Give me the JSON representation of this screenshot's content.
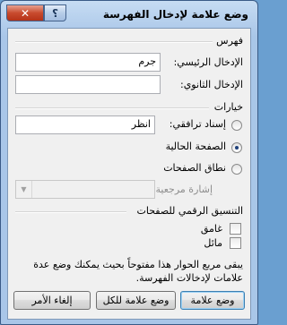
{
  "window": {
    "title": "وضع علامة لإدخال الفهرسة",
    "help_glyph": "؟",
    "close_glyph": "✕"
  },
  "index_group": {
    "title": "فهرس",
    "main_entry_label": "الإدخال الرئيسي:",
    "main_entry_value": "جرم",
    "subentry_label": "الإدخال الثانوي:",
    "subentry_value": ""
  },
  "options_group": {
    "title": "خيارات",
    "cross_reference_label": "إسناد ترافقي:",
    "cross_reference_value": "انظر",
    "current_page_label": "الصفحة الحالية",
    "page_range_label": "نطاق الصفحات",
    "bookmark_label": "إشارة مرجعية:",
    "selected_option": "current_page"
  },
  "format_group": {
    "title": "التنسيق الرقمي للصفحات",
    "bold_label": "غامق",
    "italic_label": "مائل"
  },
  "note": "يبقى مربع الحوار هذا مفتوحاً بحيث يمكنك وضع عدة علامات لإدخالات الفهرسة.",
  "buttons": {
    "mark": "وضع علامة",
    "mark_all": "وضع علامة للكل",
    "cancel": "إلغاء الأمر"
  }
}
